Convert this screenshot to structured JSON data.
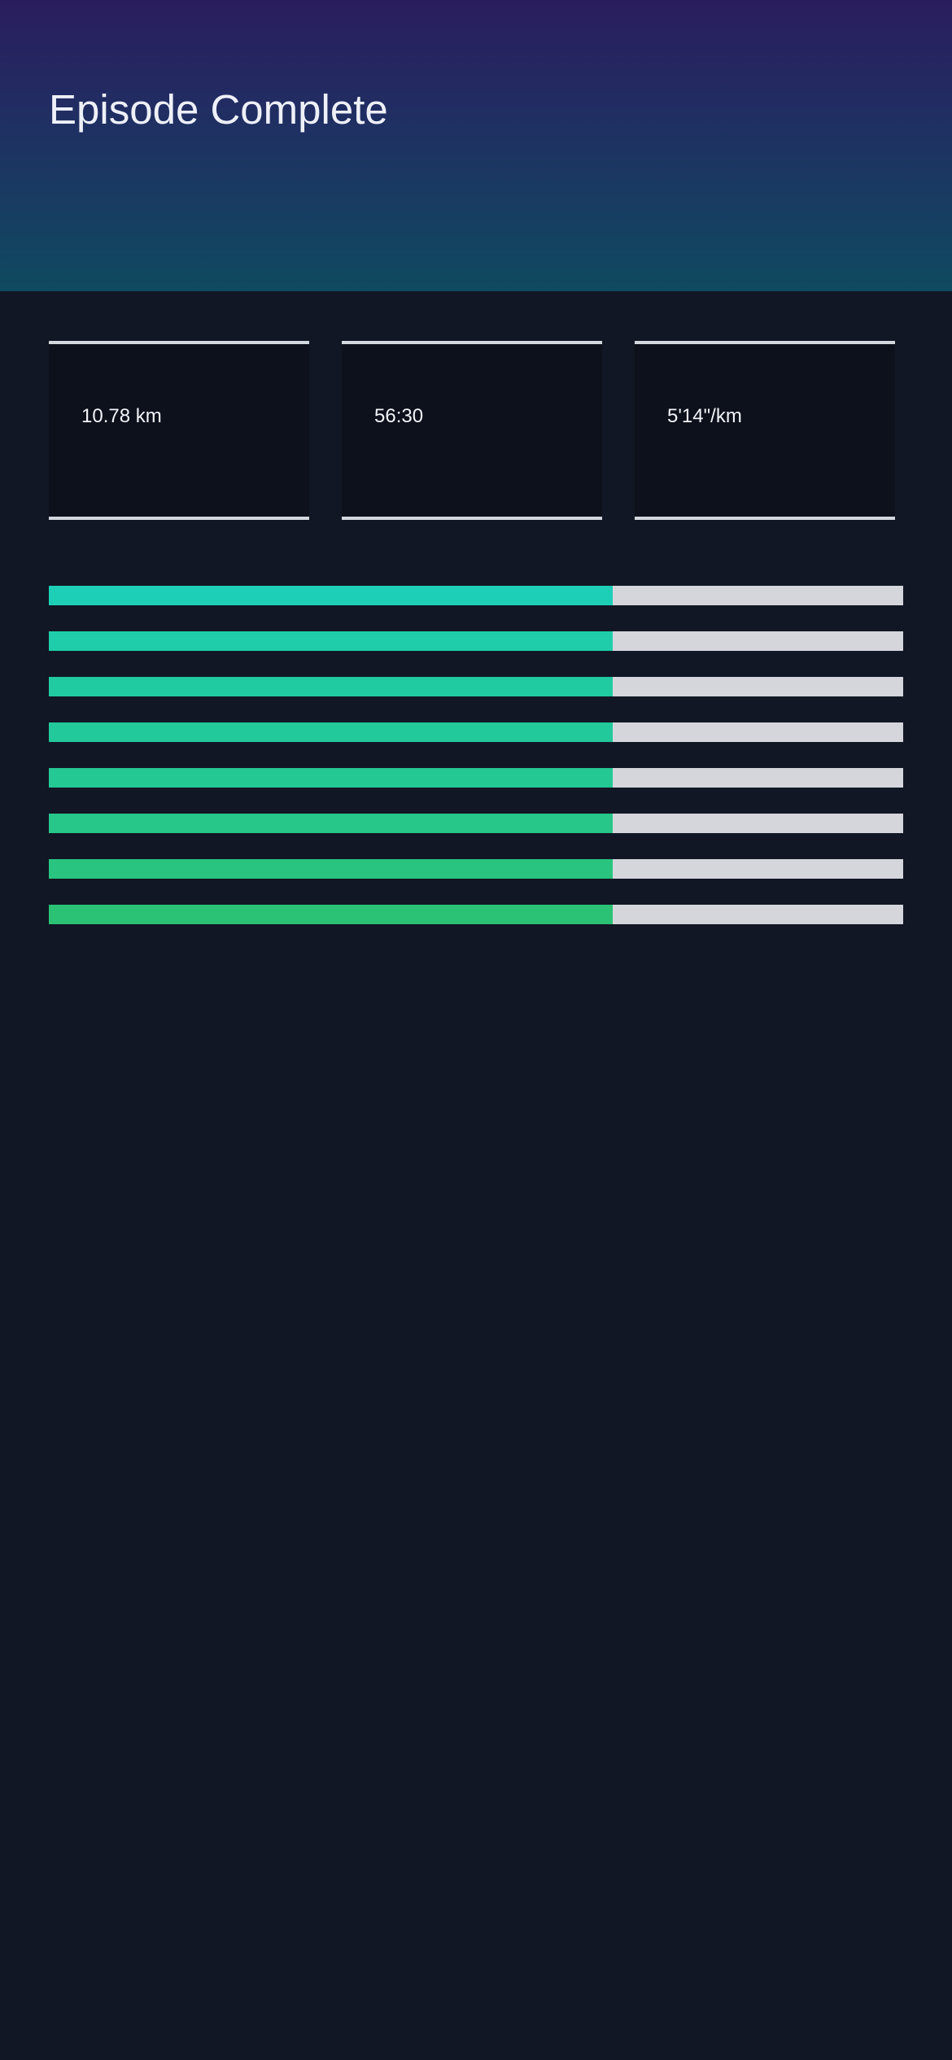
{
  "header": {
    "title": "Episode Complete"
  },
  "stats": [
    {
      "value": "10.78 km"
    },
    {
      "value": "56:30"
    },
    {
      "value": "5'14\"/km"
    }
  ],
  "progress_bars": [
    {
      "level_percent": 66,
      "color": "#1ecfb8"
    },
    {
      "level_percent": 66,
      "color": "#1fcdaa"
    },
    {
      "level_percent": 66,
      "color": "#21cba2"
    },
    {
      "level_percent": 66,
      "color": "#22c99b"
    },
    {
      "level_percent": 66,
      "color": "#24c893"
    },
    {
      "level_percent": 66,
      "color": "#27c689"
    },
    {
      "level_percent": 66,
      "color": "#29c47f"
    },
    {
      "level_percent": 66,
      "color": "#2bc275"
    }
  ],
  "colors": {
    "background": "#111724",
    "card_background": "#0c111b",
    "card_border": "#d3d7de",
    "bar_track": "#d4d6db"
  }
}
